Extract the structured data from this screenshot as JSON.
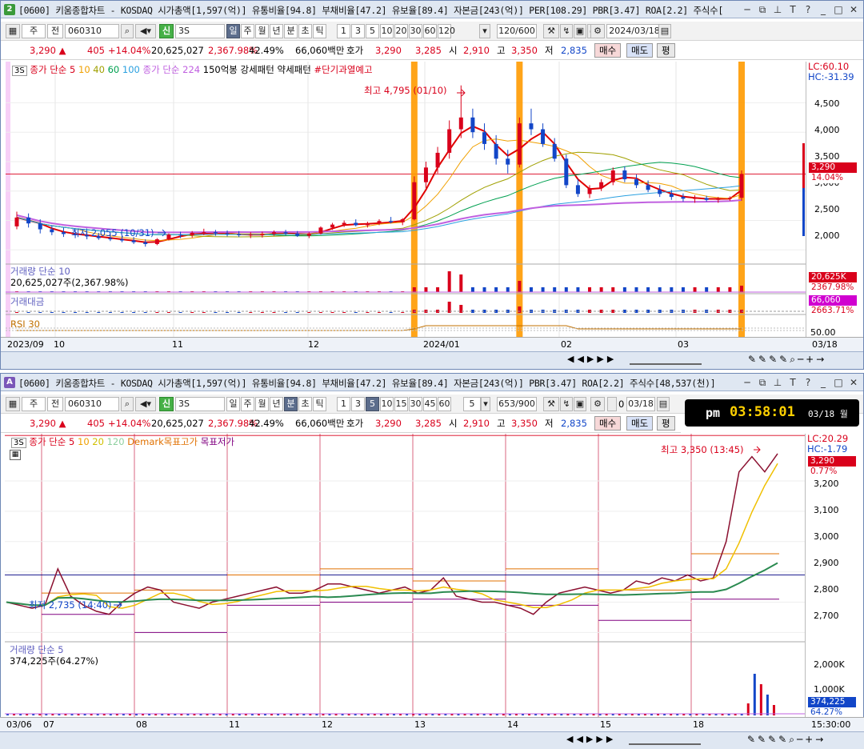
{
  "colors": {
    "up": "#d9001b",
    "down": "#1246c8",
    "ma5": "#e00000",
    "ma10": "#f0a000",
    "ma40": "#a0a000",
    "ma60": "#00a050",
    "ma100": "#2aa0e0",
    "ma224": "#c060e0",
    "vline": "#ff9a00"
  },
  "top": {
    "win_num": "2",
    "title": "[0600] 키움종합차트 - KOSDAQ 시가총액[1,597(억)] 유통비율[94.8] 부채비율[47.2] 유보율[89.4] 자본금[243(억)] PER[108.29] PBR[3.47] ROA[2.2] 주식수[",
    "mode_btn": "주",
    "prev_btn": "전",
    "code": "060310",
    "shin": "신",
    "name": "3S",
    "periods": [
      "일",
      "주",
      "월",
      "년",
      "분",
      "초",
      "틱"
    ],
    "nums": [
      "1",
      "3",
      "5",
      "10",
      "20",
      "30",
      "60",
      "120"
    ],
    "count": "120/600",
    "date": "2024/03/18",
    "quote": {
      "price": "3,290 ▲",
      "change": "405",
      "rate": "+14.04%",
      "volume": "20,625,027",
      "vol_rate": "2,367.98%",
      "turnover": "42.49%",
      "amount": "66,060백만",
      "hoga_label": "호가",
      "ask": "3,290",
      "bid": "3,285",
      "open_label": "시",
      "open": "2,910",
      "high_label": "고",
      "high": "3,350",
      "low_label": "저",
      "low": "2,835",
      "buy": "매수",
      "sell": "매도",
      "eval": "평"
    },
    "legend": {
      "tag": "3S",
      "ma": "종가 단순",
      "p5": "5",
      "p10": "10",
      "p40": "40",
      "p60": "60",
      "p100": "100",
      "ma224": "종가 단순 224",
      "pat": "150억봉 강세패턴  약세패턴",
      "warn": "#단기과열예고"
    },
    "y_ticks": [
      "4,500",
      "4,000",
      "3,500",
      "3,000",
      "2,500",
      "2,000"
    ],
    "lc": "LC:60.10",
    "hc": "HC:-31.39",
    "price_tag": "3,290",
    "pct_tag": "14.04%",
    "high_note": "최고 4,795 (01/10)",
    "low_note": "최저 2,055 (10/31)",
    "vol_title": "거래량  단순 10",
    "vol_value": "20,625,027주(2,367.98%)",
    "vol_tag1": "20,625K",
    "vol_tag2": "2367.98%",
    "amt_title": "거래대금",
    "amt_tag1": "66,060",
    "amt_tag2": "2663.71%",
    "rsi_title": "RSI 30",
    "rsi_tick": "50.00",
    "x_ticks": [
      "2023/09",
      "10",
      "11",
      "12",
      "2024/01",
      "02",
      "03"
    ],
    "x_end": "03/18"
  },
  "top_chart": {
    "type": "candlestick",
    "ohlc": [
      [
        2400,
        2650,
        2350,
        2550
      ],
      [
        2550,
        2620,
        2380,
        2450
      ],
      [
        2450,
        2520,
        2280,
        2350
      ],
      [
        2350,
        2420,
        2250,
        2300
      ],
      [
        2300,
        2380,
        2220,
        2270
      ],
      [
        2270,
        2330,
        2200,
        2250
      ],
      [
        2250,
        2310,
        2180,
        2230
      ],
      [
        2230,
        2290,
        2170,
        2200
      ],
      [
        2200,
        2260,
        2150,
        2180
      ],
      [
        2180,
        2240,
        2130,
        2160
      ],
      [
        2160,
        2220,
        2100,
        2130
      ],
      [
        2130,
        2180,
        2055,
        2100
      ],
      [
        2100,
        2200,
        2080,
        2180
      ],
      [
        2180,
        2280,
        2160,
        2260
      ],
      [
        2260,
        2310,
        2200,
        2250
      ],
      [
        2250,
        2320,
        2210,
        2290
      ],
      [
        2290,
        2360,
        2250,
        2300
      ],
      [
        2300,
        2340,
        2240,
        2280
      ],
      [
        2280,
        2330,
        2230,
        2270
      ],
      [
        2270,
        2320,
        2220,
        2250
      ],
      [
        2250,
        2300,
        2200,
        2260
      ],
      [
        2260,
        2310,
        2210,
        2270
      ],
      [
        2270,
        2330,
        2240,
        2300
      ],
      [
        2300,
        2340,
        2250,
        2280
      ],
      [
        2280,
        2320,
        2220,
        2240
      ],
      [
        2240,
        2300,
        2200,
        2280
      ],
      [
        2280,
        2400,
        2260,
        2380
      ],
      [
        2380,
        2460,
        2340,
        2430
      ],
      [
        2430,
        2500,
        2390,
        2460
      ],
      [
        2460,
        2520,
        2400,
        2420
      ],
      [
        2420,
        2480,
        2380,
        2450
      ],
      [
        2450,
        2520,
        2420,
        2490
      ],
      [
        2490,
        2560,
        2450,
        2470
      ],
      [
        2470,
        2540,
        2420,
        2520
      ],
      [
        2520,
        3250,
        2500,
        3150
      ],
      [
        3150,
        3500,
        3050,
        3400
      ],
      [
        3400,
        3750,
        3300,
        3650
      ],
      [
        3650,
        4200,
        3550,
        4050
      ],
      [
        4050,
        4795,
        3900,
        4250
      ],
      [
        4250,
        4400,
        3900,
        4000
      ],
      [
        4000,
        4150,
        3700,
        3800
      ],
      [
        3800,
        3950,
        3450,
        3550
      ],
      [
        3550,
        3700,
        3300,
        3450
      ],
      [
        3450,
        4250,
        3400,
        4150
      ],
      [
        4150,
        4400,
        3950,
        4050
      ],
      [
        4050,
        4150,
        3750,
        3800
      ],
      [
        3800,
        3900,
        3500,
        3550
      ],
      [
        3550,
        3620,
        3050,
        3100
      ],
      [
        3100,
        3200,
        2900,
        2950
      ],
      [
        2950,
        3100,
        2880,
        3050
      ],
      [
        3050,
        3200,
        3000,
        3150
      ],
      [
        3150,
        3400,
        3100,
        3350
      ],
      [
        3350,
        3420,
        3150,
        3200
      ],
      [
        3200,
        3280,
        3050,
        3100
      ],
      [
        3100,
        3180,
        2980,
        3020
      ],
      [
        3020,
        3100,
        2900,
        2950
      ],
      [
        2950,
        3020,
        2850,
        2900
      ],
      [
        2900,
        2960,
        2820,
        2870
      ],
      [
        2870,
        2930,
        2800,
        2880
      ],
      [
        2880,
        2920,
        2820,
        2850
      ],
      [
        2850,
        2900,
        2800,
        2870
      ],
      [
        2870,
        2910,
        2835,
        2885
      ],
      [
        2885,
        3350,
        2835,
        3290
      ]
    ],
    "y_range": [
      1800,
      4900
    ],
    "mark_bars": [
      34,
      43,
      62
    ]
  },
  "bottom": {
    "win_num": "A",
    "title": "[0600] 키움종합차트 - KOSDAQ 시가총액[1,597(억)] 유통비율[94.8] 부채비율[47.2] 유보율[89.4] 자본금[243(억)] PBR[3.47] ROA[2.2] 주식수[48,537(천)]",
    "mode_btn": "주",
    "prev_btn": "전",
    "code": "060310",
    "shin": "신",
    "name": "3S",
    "periods": [
      "일",
      "주",
      "월",
      "년",
      "분",
      "초",
      "틱"
    ],
    "nums": [
      "1",
      "3",
      "5",
      "10",
      "15",
      "30",
      "45",
      "60"
    ],
    "interval": "5",
    "count": "653/900",
    "zero": "0",
    "date": "03/18",
    "clock": {
      "ampm": "pm",
      "time": "03:58:01",
      "date": "03/18 월"
    },
    "legend": {
      "tag": "3S",
      "ma": "종가 단순",
      "p5": "5",
      "p10": "10",
      "p20": "20",
      "p120": "120",
      "dm_hi": "Demark목표고가",
      "dm_lo": "목표저가"
    },
    "y_ticks": [
      "3,200",
      "3,100",
      "3,000",
      "2,900",
      "2,800",
      "2,700"
    ],
    "lc": "LC:20.29",
    "hc": "HC:-1.79",
    "price_tag": "3,290",
    "pct_tag": "0.77%",
    "high_note": "최고 3,350 (13:45)",
    "low_note": "최저 2,735 (14:40)",
    "vol_title": "거래량  단순 5",
    "vol_value": "374,225주(64.27%)",
    "vol_ticks": [
      "2,000K",
      "1,000K"
    ],
    "vol_tag1": "374,225",
    "vol_tag2": "64.27%",
    "x_ticks": [
      "03/06",
      "07",
      "08",
      "11",
      "12",
      "13",
      "14",
      "15",
      "18"
    ],
    "x_end": "15:30:00"
  },
  "bottom_chart": {
    "type": "line",
    "sessions": [
      "07",
      "08",
      "11",
      "12",
      "13",
      "14",
      "15",
      "18"
    ],
    "y_range": [
      2680,
      3340
    ],
    "close": [
      2800,
      2790,
      2780,
      2790,
      2910,
      2820,
      2790,
      2770,
      2760,
      2800,
      2830,
      2850,
      2840,
      2800,
      2790,
      2780,
      2800,
      2810,
      2820,
      2830,
      2840,
      2850,
      2830,
      2830,
      2840,
      2860,
      2860,
      2850,
      2840,
      2830,
      2840,
      2850,
      2830,
      2840,
      2880,
      2820,
      2810,
      2800,
      2800,
      2790,
      2780,
      2760,
      2800,
      2830,
      2840,
      2850,
      2840,
      2830,
      2840,
      2870,
      2860,
      2880,
      2870,
      2890,
      2870,
      2880,
      3000,
      3230,
      3280,
      3230,
      3290
    ]
  }
}
